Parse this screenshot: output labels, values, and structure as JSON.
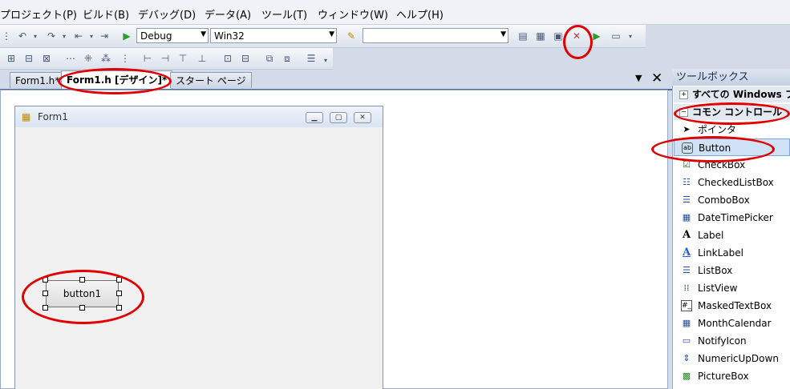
{
  "menu": [
    "プロジェクト(P)",
    "ビルド(B)",
    "デバッグ(D)",
    "データ(A)",
    "ツール(T)",
    "ウィンドウ(W)",
    "ヘルプ(H)"
  ],
  "toolbar": {
    "config": "Debug",
    "platform": "Win32",
    "search": ""
  },
  "tabs": [
    "Form1.h*",
    "Form1.h [デザイン]*",
    "スタート ページ"
  ],
  "form": {
    "title": "Form1",
    "button_text": "button1"
  },
  "toolbox": {
    "title": "ツールボックス",
    "group_all": "すべての Windows フォーム",
    "group_common": "コモン コントロール",
    "items": [
      "ポインタ",
      "Button",
      "CheckBox",
      "CheckedListBox",
      "ComboBox",
      "DateTimePicker",
      "Label",
      "LinkLabel",
      "ListBox",
      "ListView",
      "MaskedTextBox",
      "MonthCalendar",
      "NotifyIcon",
      "NumericUpDown",
      "PictureBox"
    ]
  },
  "colors": {
    "annotation": "#e10000",
    "accent": "#4a6ba5"
  }
}
